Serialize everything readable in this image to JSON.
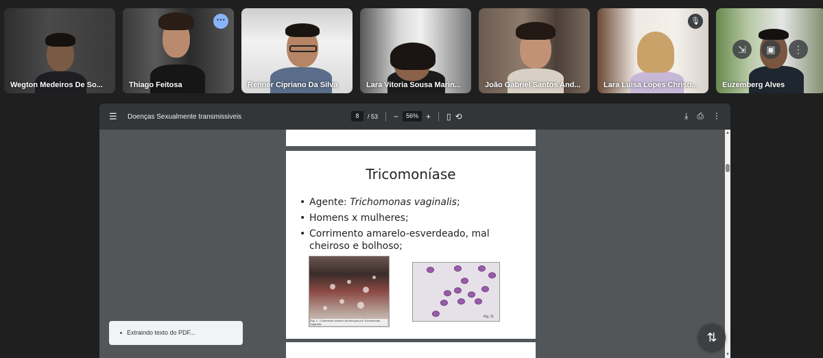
{
  "participants": [
    {
      "name": "Wegton Medeiros De So...",
      "active": false
    },
    {
      "name": "Thiago Feitosa",
      "active": true
    },
    {
      "name": "Renner Cipriano Da Silva",
      "active": false
    },
    {
      "name": "Lara Vitoria Sousa Marin...",
      "active": false
    },
    {
      "name": "João Gabriel Santos And...",
      "active": false
    },
    {
      "name": "Lara Luisa Lopes Chriso...",
      "active": false,
      "muted": true
    },
    {
      "name": "Euzemberg Alves",
      "active": false
    }
  ],
  "pdf": {
    "title": "Doenças Sexualmente transmissiveis",
    "current_page": "8",
    "total_pages": "/ 53",
    "zoom": "56%"
  },
  "slide": {
    "title": "Tricomoníase",
    "bullet_1_prefix": "Agente: ",
    "bullet_1_italic": "Trichomonas vaginalis",
    "bullet_1_suffix": ";",
    "bullet_2": "Homens x mulheres;",
    "bullet_3": "Corrimento amarelo-esverdeado, mal cheiroso e bolhoso;",
    "figure_1_caption": "Fig. 1 - Corrimento bolhoso da infecção por Trichomonas vaginalis",
    "figure_2_caption": "Fig. 11"
  },
  "toast": {
    "text": "Extraindo texto do PDF..."
  },
  "colors": {
    "accent": "#8ab4f8",
    "toolbar": "#323639",
    "viewer_bg": "#525659"
  }
}
